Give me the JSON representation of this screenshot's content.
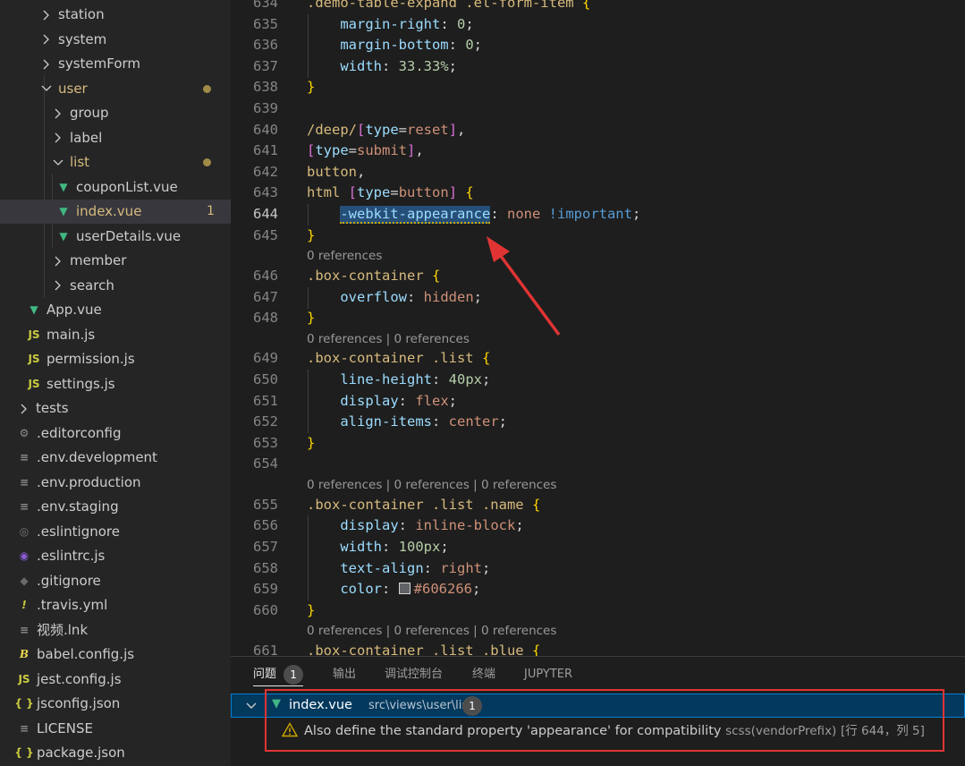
{
  "explorer": {
    "items": [
      {
        "label": "station",
        "kind": "folder-closed",
        "depth": 2
      },
      {
        "label": "system",
        "kind": "folder-closed",
        "depth": 2
      },
      {
        "label": "systemForm",
        "kind": "folder-closed",
        "depth": 2
      },
      {
        "label": "user",
        "kind": "folder-open",
        "depth": 2,
        "modified": true
      },
      {
        "label": "group",
        "kind": "folder-closed",
        "depth": 3
      },
      {
        "label": "label",
        "kind": "folder-closed",
        "depth": 3
      },
      {
        "label": "list",
        "kind": "folder-open",
        "depth": 3,
        "modified": true
      },
      {
        "label": "couponList.vue",
        "kind": "vue",
        "depth": 4
      },
      {
        "label": "index.vue",
        "kind": "vue",
        "depth": 4,
        "modified": true,
        "selected": true,
        "problem_count": "1"
      },
      {
        "label": "userDetails.vue",
        "kind": "vue",
        "depth": 4
      },
      {
        "label": "member",
        "kind": "folder-closed",
        "depth": 3
      },
      {
        "label": "search",
        "kind": "folder-closed",
        "depth": 3
      },
      {
        "label": "App.vue",
        "kind": "vue",
        "depth": 1
      },
      {
        "label": "main.js",
        "kind": "js",
        "depth": 1
      },
      {
        "label": "permission.js",
        "kind": "js",
        "depth": 1
      },
      {
        "label": "settings.js",
        "kind": "js",
        "depth": 1
      },
      {
        "label": "tests",
        "kind": "folder-closed",
        "depth": 0
      },
      {
        "label": ".editorconfig",
        "kind": "gear",
        "depth": 0
      },
      {
        "label": ".env.development",
        "kind": "lines",
        "depth": 0
      },
      {
        "label": ".env.production",
        "kind": "lines",
        "depth": 0
      },
      {
        "label": ".env.staging",
        "kind": "lines",
        "depth": 0
      },
      {
        "label": ".eslintignore",
        "kind": "ring",
        "depth": 0
      },
      {
        "label": ".eslintrc.js",
        "kind": "eslintrc",
        "depth": 0
      },
      {
        "label": ".gitignore",
        "kind": "git",
        "depth": 0
      },
      {
        "label": ".travis.yml",
        "kind": "bang",
        "depth": 0
      },
      {
        "label": "视频.lnk",
        "kind": "lines",
        "depth": 0
      },
      {
        "label": "babel.config.js",
        "kind": "babel",
        "depth": 0
      },
      {
        "label": "jest.config.js",
        "kind": "js",
        "depth": 0
      },
      {
        "label": "jsconfig.json",
        "kind": "json",
        "depth": 0
      },
      {
        "label": "LICENSE",
        "kind": "license",
        "depth": 0
      },
      {
        "label": "package.json",
        "kind": "json",
        "depth": 0
      }
    ]
  },
  "icon_glyphs": {
    "vue": "▼",
    "js": "JS",
    "gear": "⚙",
    "lines": "≡",
    "ring": "◎",
    "eslintrc": "◉",
    "git": "◆",
    "bang": "!",
    "babel": "B",
    "json": "{ }",
    "license": "≡"
  },
  "editor": {
    "lines": [
      {
        "kind": "code",
        "num": "634",
        "tokens": [
          [
            "sel",
            ".demo-table-expand .el-form-item "
          ],
          [
            "brace",
            "{"
          ]
        ]
      },
      {
        "kind": "code",
        "num": "635",
        "indent": 1,
        "tokens": [
          [
            "prop",
            "margin-right"
          ],
          [
            "punc",
            ": "
          ],
          [
            "num",
            "0"
          ],
          [
            "punc",
            ";"
          ]
        ]
      },
      {
        "kind": "code",
        "num": "636",
        "indent": 1,
        "tokens": [
          [
            "prop",
            "margin-bottom"
          ],
          [
            "punc",
            ": "
          ],
          [
            "num",
            "0"
          ],
          [
            "punc",
            ";"
          ]
        ]
      },
      {
        "kind": "code",
        "num": "637",
        "indent": 1,
        "tokens": [
          [
            "prop",
            "width"
          ],
          [
            "punc",
            ": "
          ],
          [
            "num",
            "33.33%"
          ],
          [
            "punc",
            ";"
          ]
        ]
      },
      {
        "kind": "code",
        "num": "638",
        "tokens": [
          [
            "brace",
            "}"
          ]
        ]
      },
      {
        "kind": "code",
        "num": "639",
        "tokens": []
      },
      {
        "kind": "code",
        "num": "640",
        "tokens": [
          [
            "sel",
            "/deep/"
          ],
          [
            "brk",
            "["
          ],
          [
            "prop",
            "type"
          ],
          [
            "punc",
            "="
          ],
          [
            "str",
            "reset"
          ],
          [
            "brk",
            "]"
          ],
          [
            "punc",
            ","
          ]
        ]
      },
      {
        "kind": "code",
        "num": "641",
        "tokens": [
          [
            "brk",
            "["
          ],
          [
            "prop",
            "type"
          ],
          [
            "punc",
            "="
          ],
          [
            "str",
            "submit"
          ],
          [
            "brk",
            "]"
          ],
          [
            "punc",
            ","
          ]
        ]
      },
      {
        "kind": "code",
        "num": "642",
        "tokens": [
          [
            "sel",
            "button"
          ],
          [
            "punc",
            ","
          ]
        ]
      },
      {
        "kind": "code",
        "num": "643",
        "tokens": [
          [
            "sel",
            "html "
          ],
          [
            "brk",
            "["
          ],
          [
            "prop",
            "type"
          ],
          [
            "punc",
            "="
          ],
          [
            "str",
            "button"
          ],
          [
            "brk",
            "]"
          ],
          [
            "punc",
            " "
          ],
          [
            "brace",
            "{"
          ]
        ]
      },
      {
        "kind": "code",
        "num": "644",
        "active": true,
        "indent": 1,
        "tokens": [
          [
            "prop-hl",
            "-webkit-appearance"
          ],
          [
            "punc",
            ": "
          ],
          [
            "str",
            "none "
          ],
          [
            "imp",
            "!important"
          ],
          [
            "punc",
            ";"
          ]
        ]
      },
      {
        "kind": "code",
        "num": "645",
        "tokens": [
          [
            "brace",
            "}"
          ]
        ]
      },
      {
        "kind": "lens",
        "text": "0 references"
      },
      {
        "kind": "code",
        "num": "646",
        "tokens": [
          [
            "sel",
            ".box-container "
          ],
          [
            "brace",
            "{"
          ]
        ]
      },
      {
        "kind": "code",
        "num": "647",
        "indent": 1,
        "tokens": [
          [
            "prop",
            "overflow"
          ],
          [
            "punc",
            ": "
          ],
          [
            "str",
            "hidden"
          ],
          [
            "punc",
            ";"
          ]
        ]
      },
      {
        "kind": "code",
        "num": "648",
        "tokens": [
          [
            "brace",
            "}"
          ]
        ]
      },
      {
        "kind": "lens",
        "text": "0 references | 0 references"
      },
      {
        "kind": "code",
        "num": "649",
        "tokens": [
          [
            "sel",
            ".box-container .list "
          ],
          [
            "brace",
            "{"
          ]
        ]
      },
      {
        "kind": "code",
        "num": "650",
        "indent": 1,
        "tokens": [
          [
            "prop",
            "line-height"
          ],
          [
            "punc",
            ": "
          ],
          [
            "num",
            "40px"
          ],
          [
            "punc",
            ";"
          ]
        ]
      },
      {
        "kind": "code",
        "num": "651",
        "indent": 1,
        "tokens": [
          [
            "prop",
            "display"
          ],
          [
            "punc",
            ": "
          ],
          [
            "str",
            "flex"
          ],
          [
            "punc",
            ";"
          ]
        ]
      },
      {
        "kind": "code",
        "num": "652",
        "indent": 1,
        "tokens": [
          [
            "prop",
            "align-items"
          ],
          [
            "punc",
            ": "
          ],
          [
            "str",
            "center"
          ],
          [
            "punc",
            ";"
          ]
        ]
      },
      {
        "kind": "code",
        "num": "653",
        "tokens": [
          [
            "brace",
            "}"
          ]
        ]
      },
      {
        "kind": "code",
        "num": "654",
        "tokens": []
      },
      {
        "kind": "lens",
        "text": "0 references | 0 references | 0 references"
      },
      {
        "kind": "code",
        "num": "655",
        "tokens": [
          [
            "sel",
            ".box-container .list .name "
          ],
          [
            "brace",
            "{"
          ]
        ]
      },
      {
        "kind": "code",
        "num": "656",
        "indent": 1,
        "tokens": [
          [
            "prop",
            "display"
          ],
          [
            "punc",
            ": "
          ],
          [
            "str",
            "inline-block"
          ],
          [
            "punc",
            ";"
          ]
        ]
      },
      {
        "kind": "code",
        "num": "657",
        "indent": 1,
        "tokens": [
          [
            "prop",
            "width"
          ],
          [
            "punc",
            ": "
          ],
          [
            "num",
            "100px"
          ],
          [
            "punc",
            ";"
          ]
        ]
      },
      {
        "kind": "code",
        "num": "658",
        "indent": 1,
        "tokens": [
          [
            "prop",
            "text-align"
          ],
          [
            "punc",
            ": "
          ],
          [
            "str",
            "right"
          ],
          [
            "punc",
            ";"
          ]
        ]
      },
      {
        "kind": "code",
        "num": "659",
        "indent": 1,
        "tokens": [
          [
            "prop",
            "color"
          ],
          [
            "punc",
            ": "
          ],
          [
            "swatch",
            ""
          ],
          [
            "str",
            "#606266"
          ],
          [
            "punc",
            ";"
          ]
        ]
      },
      {
        "kind": "code",
        "num": "660",
        "tokens": [
          [
            "brace",
            "}"
          ]
        ]
      },
      {
        "kind": "lens",
        "text": "0 references | 0 references | 0 references"
      },
      {
        "kind": "code",
        "num": "661",
        "tokens": [
          [
            "sel",
            ".box-container .list .blue "
          ],
          [
            "brace",
            "{"
          ]
        ]
      }
    ]
  },
  "panel": {
    "tabs": [
      {
        "label": "问题",
        "badge": "1",
        "active": true
      },
      {
        "label": "输出"
      },
      {
        "label": "调试控制台"
      },
      {
        "label": "终端"
      },
      {
        "label": "JUPYTER"
      }
    ],
    "problem_file": {
      "name": "index.vue",
      "path": "src\\views\\user\\list",
      "count": "1"
    },
    "problem": {
      "message": "Also define the standard property 'appearance' for compatibility",
      "source": "scss(vendorPrefix)",
      "location": "[行 644，列 5]"
    }
  },
  "colors": {
    "annotation": "#e03434",
    "warning": "#cca700",
    "vue_green": "#41b883"
  }
}
